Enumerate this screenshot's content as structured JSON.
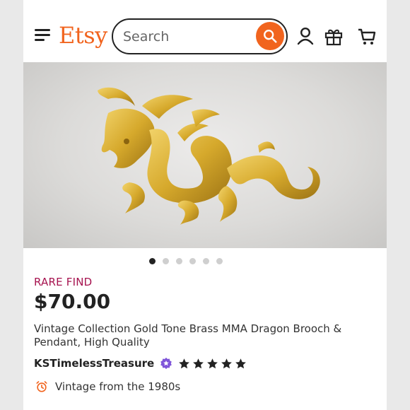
{
  "header": {
    "logo": "Etsy",
    "search_placeholder": "Search",
    "icons": [
      "menu-icon",
      "search-icon",
      "account-icon",
      "gift-icon",
      "cart-icon"
    ]
  },
  "gallery": {
    "image_count": 6,
    "active_index": 0
  },
  "listing": {
    "badge": "RARE FIND",
    "price": "$70.00",
    "title": "Vintage Collection Gold Tone Brass MMA Dragon Brooch & Pendant, High Quality",
    "shop_name": "KSTimelessTreasure",
    "rating_stars": 5,
    "vintage_note": "Vintage from the 1980s"
  },
  "colors": {
    "brand": "#f1641e",
    "badge": "#a6134f",
    "star_seller": "#7f55d9"
  }
}
